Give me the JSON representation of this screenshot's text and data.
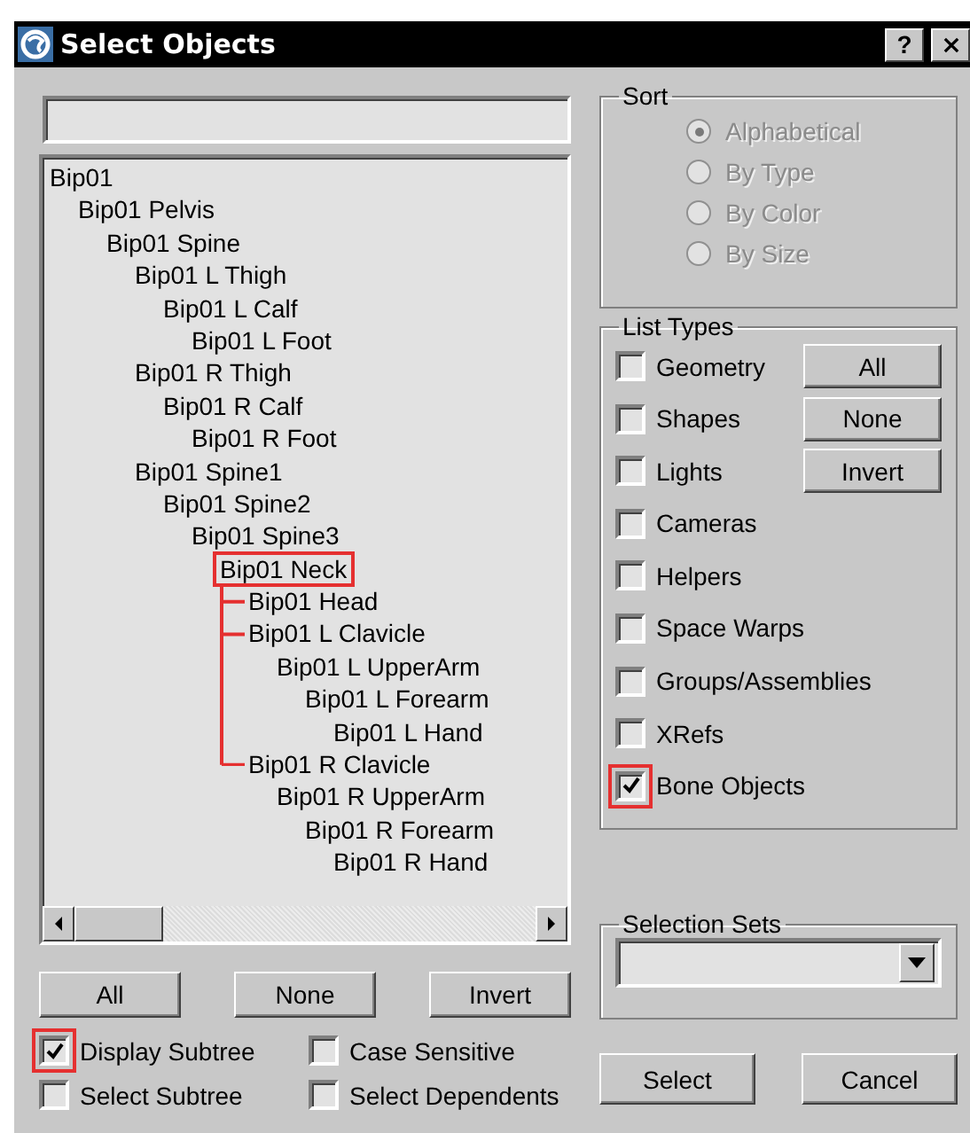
{
  "window": {
    "title": "Select Objects",
    "help": "?"
  },
  "tree": [
    {
      "label": "Bip01",
      "children": [
        {
          "label": "Bip01 Pelvis",
          "children": [
            {
              "label": "Bip01 Spine",
              "children": [
                {
                  "label": "Bip01 L Thigh",
                  "children": [
                    {
                      "label": "Bip01 L Calf",
                      "children": [
                        {
                          "label": "Bip01 L Foot"
                        }
                      ]
                    }
                  ]
                },
                {
                  "label": "Bip01 R Thigh",
                  "children": [
                    {
                      "label": "Bip01 R Calf",
                      "children": [
                        {
                          "label": "Bip01 R Foot"
                        }
                      ]
                    }
                  ]
                },
                {
                  "label": "Bip01 Spine1",
                  "children": [
                    {
                      "label": "Bip01 Spine2",
                      "children": [
                        {
                          "label": "Bip01 Spine3",
                          "children": [
                            {
                              "label": "Bip01 Neck",
                              "callout": true,
                              "children": [
                                {
                                  "label": "Bip01 Head"
                                },
                                {
                                  "label": "Bip01 L Clavicle",
                                  "children": [
                                    {
                                      "label": "Bip01 L UpperArm",
                                      "children": [
                                        {
                                          "label": "Bip01 L Forearm",
                                          "children": [
                                            {
                                              "label": "Bip01 L Hand"
                                            }
                                          ]
                                        }
                                      ]
                                    }
                                  ]
                                },
                                {
                                  "label": "Bip01 R Clavicle",
                                  "children": [
                                    {
                                      "label": "Bip01 R UpperArm",
                                      "children": [
                                        {
                                          "label": "Bip01 R Forearm",
                                          "children": [
                                            {
                                              "label": "Bip01 R Hand"
                                            }
                                          ]
                                        }
                                      ]
                                    }
                                  ]
                                }
                              ]
                            }
                          ]
                        }
                      ]
                    }
                  ]
                }
              ]
            }
          ]
        }
      ]
    }
  ],
  "list_buttons": [
    "All",
    "None",
    "Invert"
  ],
  "options": [
    {
      "label": "Display Subtree",
      "checked": true,
      "callout": true
    },
    {
      "label": "Case Sensitive",
      "checked": false
    },
    {
      "label": "Select Subtree",
      "checked": false
    },
    {
      "label": "Select Dependents",
      "checked": false
    }
  ],
  "sort": {
    "title": "Sort",
    "disabled": true,
    "options": [
      {
        "label": "Alphabetical",
        "selected": true
      },
      {
        "label": "By Type",
        "selected": false
      },
      {
        "label": "By Color",
        "selected": false
      },
      {
        "label": "By Size",
        "selected": false
      }
    ]
  },
  "list_types": {
    "title": "List Types",
    "items": [
      {
        "label": "Geometry",
        "checked": false
      },
      {
        "label": "Shapes",
        "checked": false
      },
      {
        "label": "Lights",
        "checked": false
      },
      {
        "label": "Cameras",
        "checked": false
      },
      {
        "label": "Helpers",
        "checked": false
      },
      {
        "label": "Space Warps",
        "checked": false
      },
      {
        "label": "Groups/Assemblies",
        "checked": false
      },
      {
        "label": "XRefs",
        "checked": false
      },
      {
        "label": "Bone Objects",
        "checked": true,
        "callout": true
      }
    ],
    "buttons": [
      "All",
      "None",
      "Invert"
    ]
  },
  "selection_sets": {
    "title": "Selection Sets"
  },
  "buttons": [
    "Select",
    "Cancel"
  ]
}
